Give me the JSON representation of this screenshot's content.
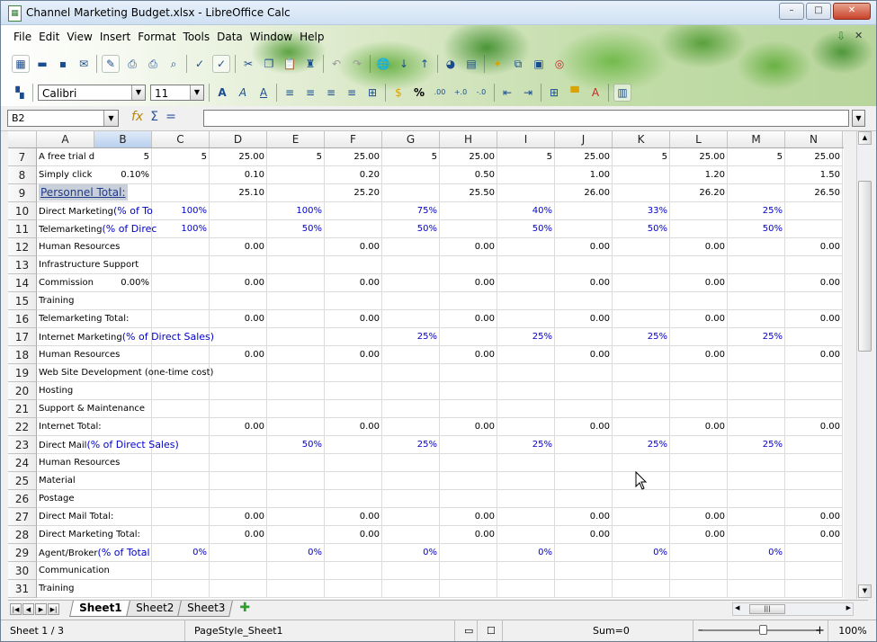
{
  "window": {
    "title": "Channel Marketing Budget.xlsx - LibreOffice Calc",
    "minimize": "–",
    "maximize": "□",
    "close": "✕"
  },
  "menu": [
    "File",
    "Edit",
    "View",
    "Insert",
    "Format",
    "Tools",
    "Data",
    "Window",
    "Help"
  ],
  "font": {
    "name": "Calibri",
    "size": "11"
  },
  "formula": {
    "cell_ref": "B2",
    "value": ""
  },
  "columns": [
    "A",
    "B",
    "C",
    "D",
    "E",
    "F",
    "G",
    "H",
    "I",
    "J",
    "K",
    "L",
    "M",
    "N"
  ],
  "selected_column": "B",
  "rows": [
    {
      "n": "7",
      "a": "A free trial d",
      "b": "5",
      "c": "5",
      "d": "25.00",
      "e": "5",
      "f": "25.00",
      "g": "5",
      "h": "25.00",
      "i": "5",
      "j": "25.00",
      "k": "5",
      "l": "25.00",
      "m": "5",
      "nval": "25.00"
    },
    {
      "n": "8",
      "a": "Simply click",
      "b": "0.10%",
      "d": "0.10",
      "f": "0.20",
      "h": "0.50",
      "j": "1.00",
      "l": "1.20",
      "nval": "1.50"
    },
    {
      "n": "9",
      "a": "Personnel Total:",
      "d": "25.10",
      "f": "25.20",
      "h": "25.50",
      "j": "26.00",
      "l": "26.20",
      "nval": "26.50"
    },
    {
      "n": "10",
      "a": "Direct Marketing",
      "a2": "(% of To",
      "c": "100%",
      "e": "100%",
      "g": "75%",
      "i": "40%",
      "k": "33%",
      "m": "25%"
    },
    {
      "n": "11",
      "a": "Telemarketing",
      "a2": "(% of Direc",
      "c": "100%",
      "e": "50%",
      "g": "50%",
      "i": "50%",
      "k": "50%",
      "m": "50%"
    },
    {
      "n": "12",
      "a": "Human Resources",
      "d": "0.00",
      "f": "0.00",
      "h": "0.00",
      "j": "0.00",
      "l": "0.00",
      "nval": "0.00"
    },
    {
      "n": "13",
      "a": "Infrastructure Support"
    },
    {
      "n": "14",
      "a": "Commission",
      "b": "0.00%",
      "d": "0.00",
      "f": "0.00",
      "h": "0.00",
      "j": "0.00",
      "l": "0.00",
      "nval": "0.00"
    },
    {
      "n": "15",
      "a": "Training"
    },
    {
      "n": "16",
      "a": "Telemarketing Total:",
      "d": "0.00",
      "f": "0.00",
      "h": "0.00",
      "j": "0.00",
      "l": "0.00",
      "nval": "0.00"
    },
    {
      "n": "17",
      "a": "Internet Marketing",
      "a2": "(% of Direct Sales)",
      "g": "25%",
      "i": "25%",
      "k": "25%",
      "m": "25%"
    },
    {
      "n": "18",
      "a": "Human Resources",
      "d": "0.00",
      "f": "0.00",
      "h": "0.00",
      "j": "0.00",
      "l": "0.00",
      "nval": "0.00"
    },
    {
      "n": "19",
      "a": "Web Site Development (one-time cost)"
    },
    {
      "n": "20",
      "a": "Hosting"
    },
    {
      "n": "21",
      "a": "Support & Maintenance"
    },
    {
      "n": "22",
      "a": "Internet Total:",
      "d": "0.00",
      "f": "0.00",
      "h": "0.00",
      "j": "0.00",
      "l": "0.00",
      "nval": "0.00"
    },
    {
      "n": "23",
      "a": "Direct Mail",
      "a2": "(% of Direct Sales)",
      "e": "50%",
      "g": "25%",
      "i": "25%",
      "k": "25%",
      "m": "25%"
    },
    {
      "n": "24",
      "a": "Human Resources"
    },
    {
      "n": "25",
      "a": "Material"
    },
    {
      "n": "26",
      "a": "Postage"
    },
    {
      "n": "27",
      "a": "Direct Mail Total:",
      "d": "0.00",
      "f": "0.00",
      "h": "0.00",
      "j": "0.00",
      "l": "0.00",
      "nval": "0.00"
    },
    {
      "n": "28",
      "a": "Direct Marketing Total:",
      "d": "0.00",
      "f": "0.00",
      "h": "0.00",
      "j": "0.00",
      "l": "0.00",
      "nval": "0.00"
    },
    {
      "n": "29",
      "a": "Agent/Broker",
      "a2": "(% of Total",
      "c": "0%",
      "e": "0%",
      "g": "0%",
      "i": "0%",
      "k": "0%",
      "m": "0%"
    },
    {
      "n": "30",
      "a": "Communication"
    },
    {
      "n": "31",
      "a": "Training"
    }
  ],
  "sheet_tabs": [
    "Sheet1",
    "Sheet2",
    "Sheet3"
  ],
  "active_tab": "Sheet1",
  "status": {
    "sheet": "Sheet 1 / 3",
    "page_style": "PageStyle_Sheet1",
    "sum": "Sum=0",
    "zoom": "100%",
    "zoom_minus": "−",
    "zoom_plus": "+"
  }
}
